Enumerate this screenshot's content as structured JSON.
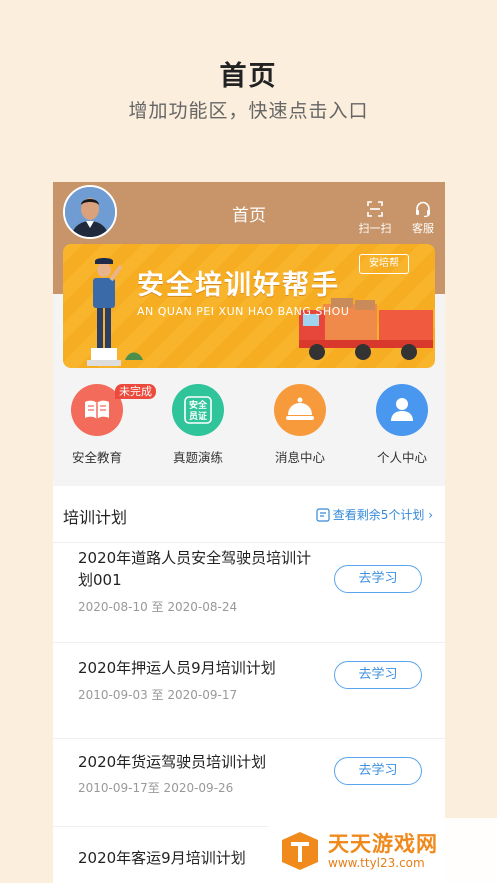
{
  "promo": {
    "title": "首页",
    "subtitle": "增加功能区，快速点击入口"
  },
  "header": {
    "title": "首页",
    "scan_label": "扫一扫",
    "service_label": "客服"
  },
  "banner": {
    "title": "安全培训好帮手",
    "subtitle": "AN QUAN PEI XUN HAO BANG SHOU",
    "logo": "安培帮"
  },
  "quick_actions": [
    {
      "label": "安全教育",
      "icon": "book-icon",
      "color": "#f26b5b",
      "badge": "未完成"
    },
    {
      "label": "真题演练",
      "icon": "certificate-icon",
      "color": "#2fc49a",
      "icon_text": "安全员证"
    },
    {
      "label": "消息中心",
      "icon": "bell-icon",
      "color": "#f79a3c"
    },
    {
      "label": "个人中心",
      "icon": "user-icon",
      "color": "#4a97ef"
    }
  ],
  "plans": {
    "title": "培训计划",
    "more_label": "查看剩余5个计划",
    "button_label": "去学习",
    "items": [
      {
        "name": "2020年道路人员安全驾驶员培训计划001",
        "date": "2020-08-10 至 2020-08-24"
      },
      {
        "name": "2020年押运人员9月培训计划",
        "date": "2010-09-03 至 2020-09-17"
      },
      {
        "name": "2020年货运驾驶员培训计划",
        "date": "2010-09-17至 2020-09-26"
      },
      {
        "name": "2020年客运9月培训计划",
        "date": ""
      }
    ]
  },
  "watermark": {
    "name": "天天游戏网",
    "url": "www.ttyl23.com"
  },
  "colors": {
    "background": "#fbeedd",
    "header": "#c8956a",
    "accent_blue": "#3d8fe0",
    "banner": "#f8b52c"
  }
}
